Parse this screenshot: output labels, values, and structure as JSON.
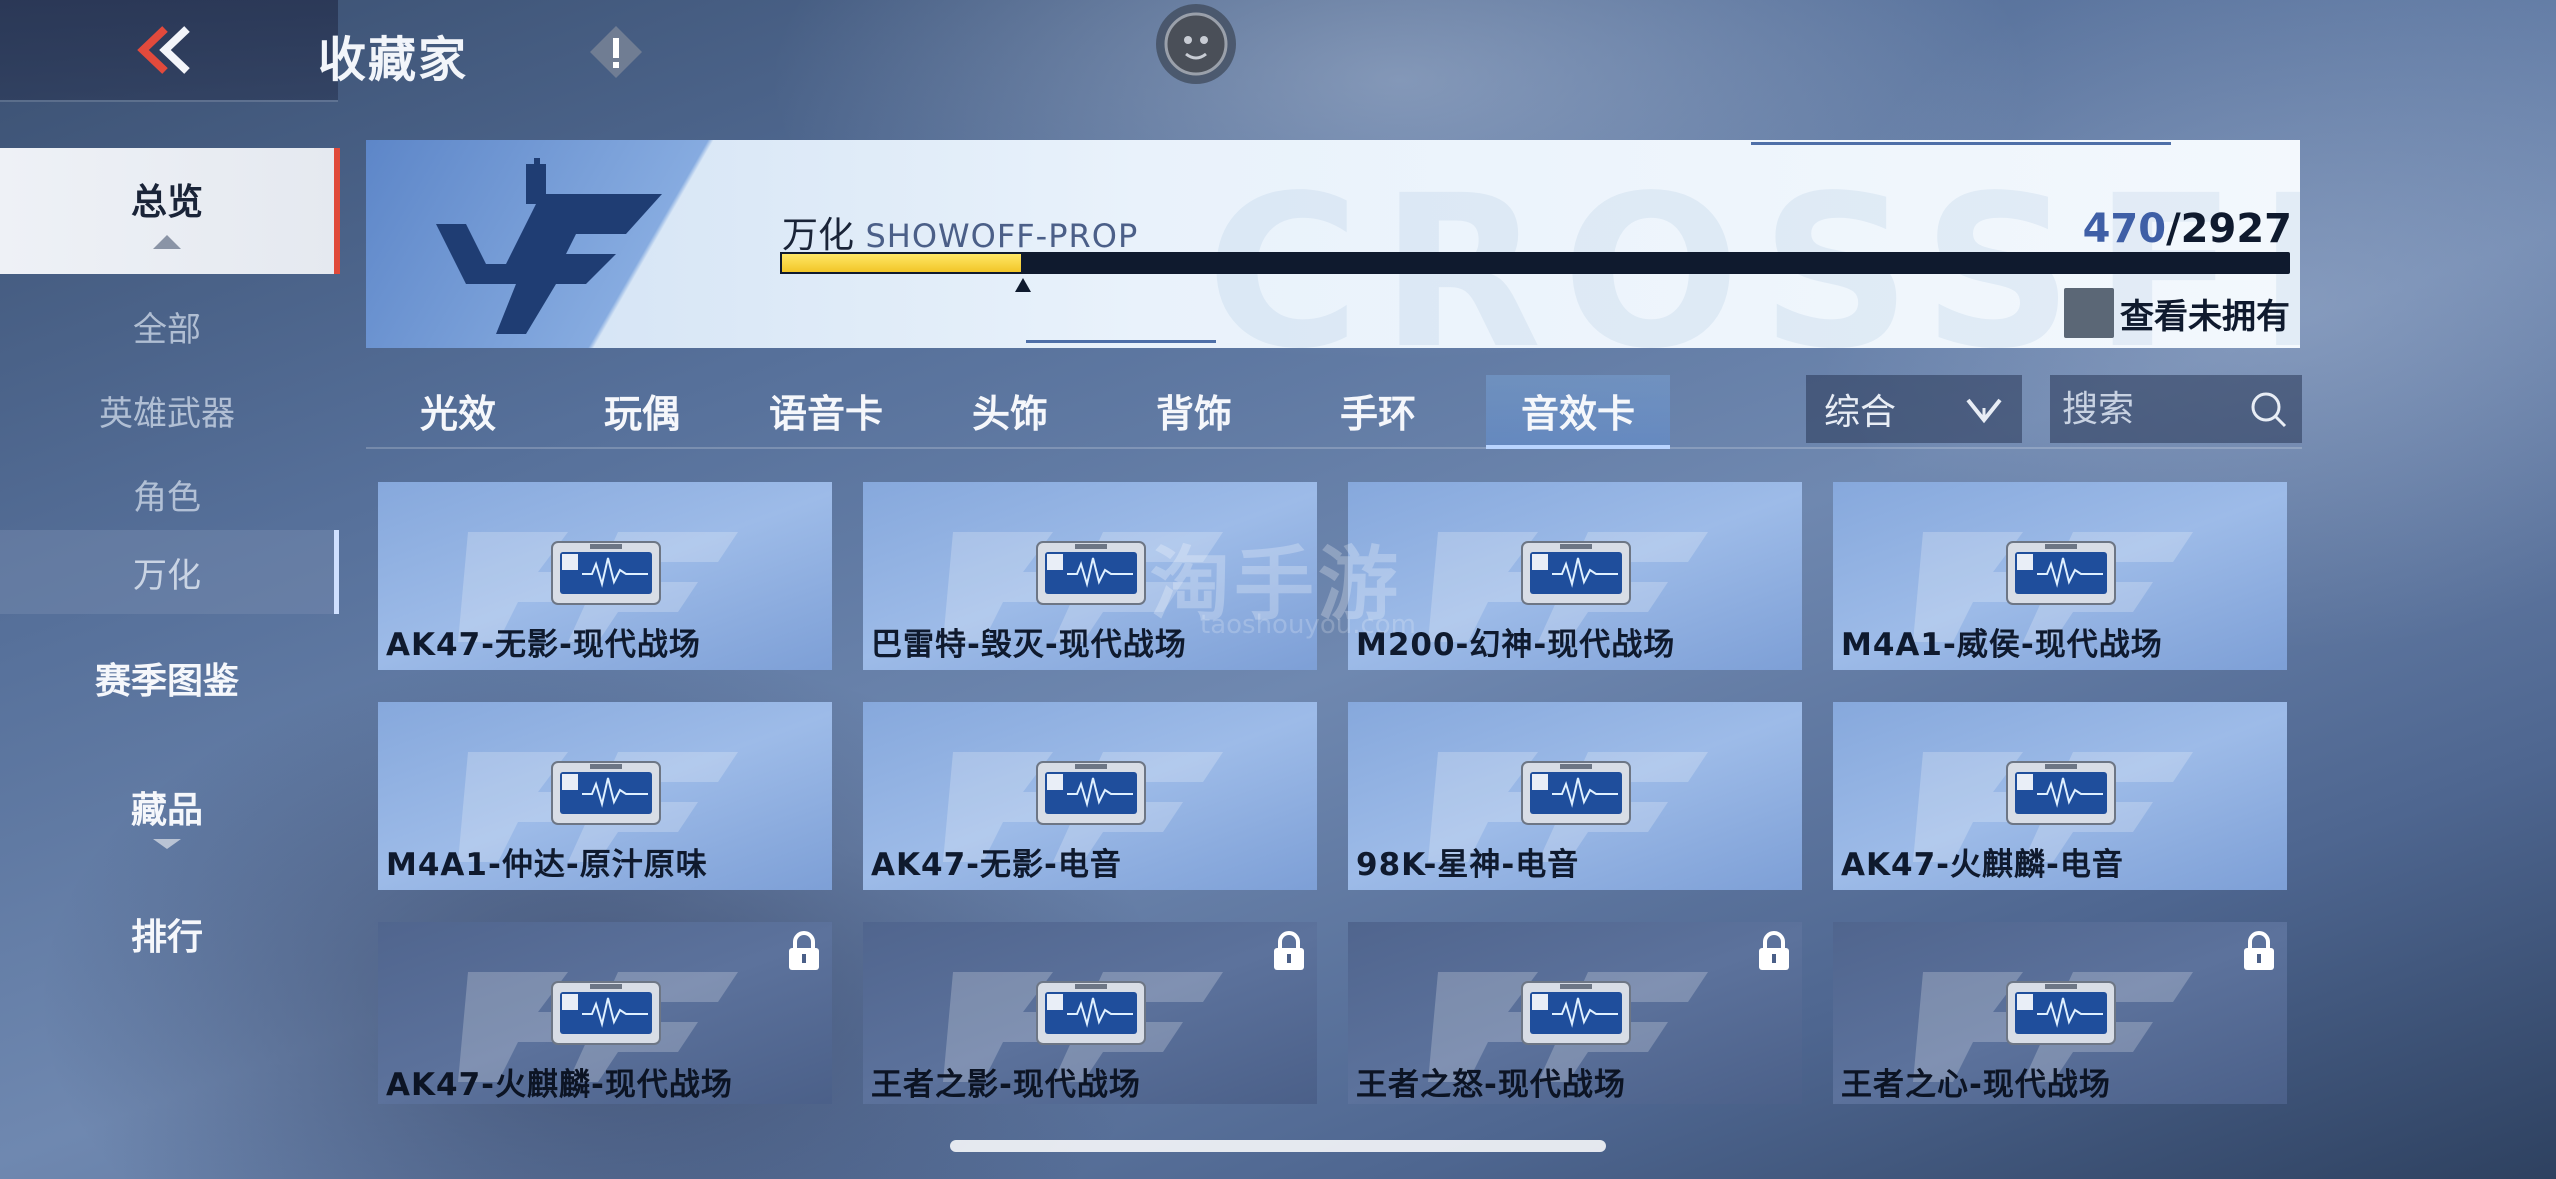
{
  "header": {
    "title": "收藏家",
    "back_icon": "double-chevron-left-icon",
    "info_icon": "exclamation-diamond-icon",
    "emblem_icon": "lion-emblem-icon"
  },
  "sidebar": {
    "items": [
      {
        "label": "总览",
        "kind": "main",
        "selected": true
      },
      {
        "label": "全部",
        "kind": "sub"
      },
      {
        "label": "英雄武器",
        "kind": "sub"
      },
      {
        "label": "角色",
        "kind": "sub"
      },
      {
        "label": "万化",
        "kind": "sub",
        "selected": true
      },
      {
        "label": "赛季图鉴",
        "kind": "main"
      },
      {
        "label": "藏品",
        "kind": "main"
      },
      {
        "label": "排行",
        "kind": "main"
      }
    ]
  },
  "banner": {
    "collection_name": "万化",
    "collection_en": "SHOWOFF-PROP",
    "owned": "470",
    "total": "/2927",
    "progress_fraction": 0.1606,
    "unowned_label": "查看未拥有",
    "accent_color": "#f2c628"
  },
  "tabs": {
    "items": [
      "光效",
      "玩偶",
      "语音卡",
      "头饰",
      "背饰",
      "手环",
      "音效卡"
    ],
    "active_index": 6
  },
  "filters": {
    "sort_value": "综合",
    "search_placeholder": "搜索"
  },
  "cards": [
    {
      "label": "AK47-无影-现代战场",
      "locked": false
    },
    {
      "label": "巴雷特-毁灭-现代战场",
      "locked": false
    },
    {
      "label": "M200-幻神-现代战场",
      "locked": false
    },
    {
      "label": "M4A1-威侯-现代战场",
      "locked": false
    },
    {
      "label": "M4A1-仲达-原汁原味",
      "locked": false
    },
    {
      "label": "AK47-无影-电音",
      "locked": false
    },
    {
      "label": "98K-星神-电音",
      "locked": false
    },
    {
      "label": "AK47-火麒麟-电音",
      "locked": false
    },
    {
      "label": "AK47-火麒麟-现代战场",
      "locked": true
    },
    {
      "label": "王者之影-现代战场",
      "locked": true
    },
    {
      "label": "王者之怒-现代战场",
      "locked": true
    },
    {
      "label": "王者之心-现代战场",
      "locked": true
    }
  ],
  "watermark": {
    "text": "淘手游",
    "sub": "taoshouyou.com"
  }
}
